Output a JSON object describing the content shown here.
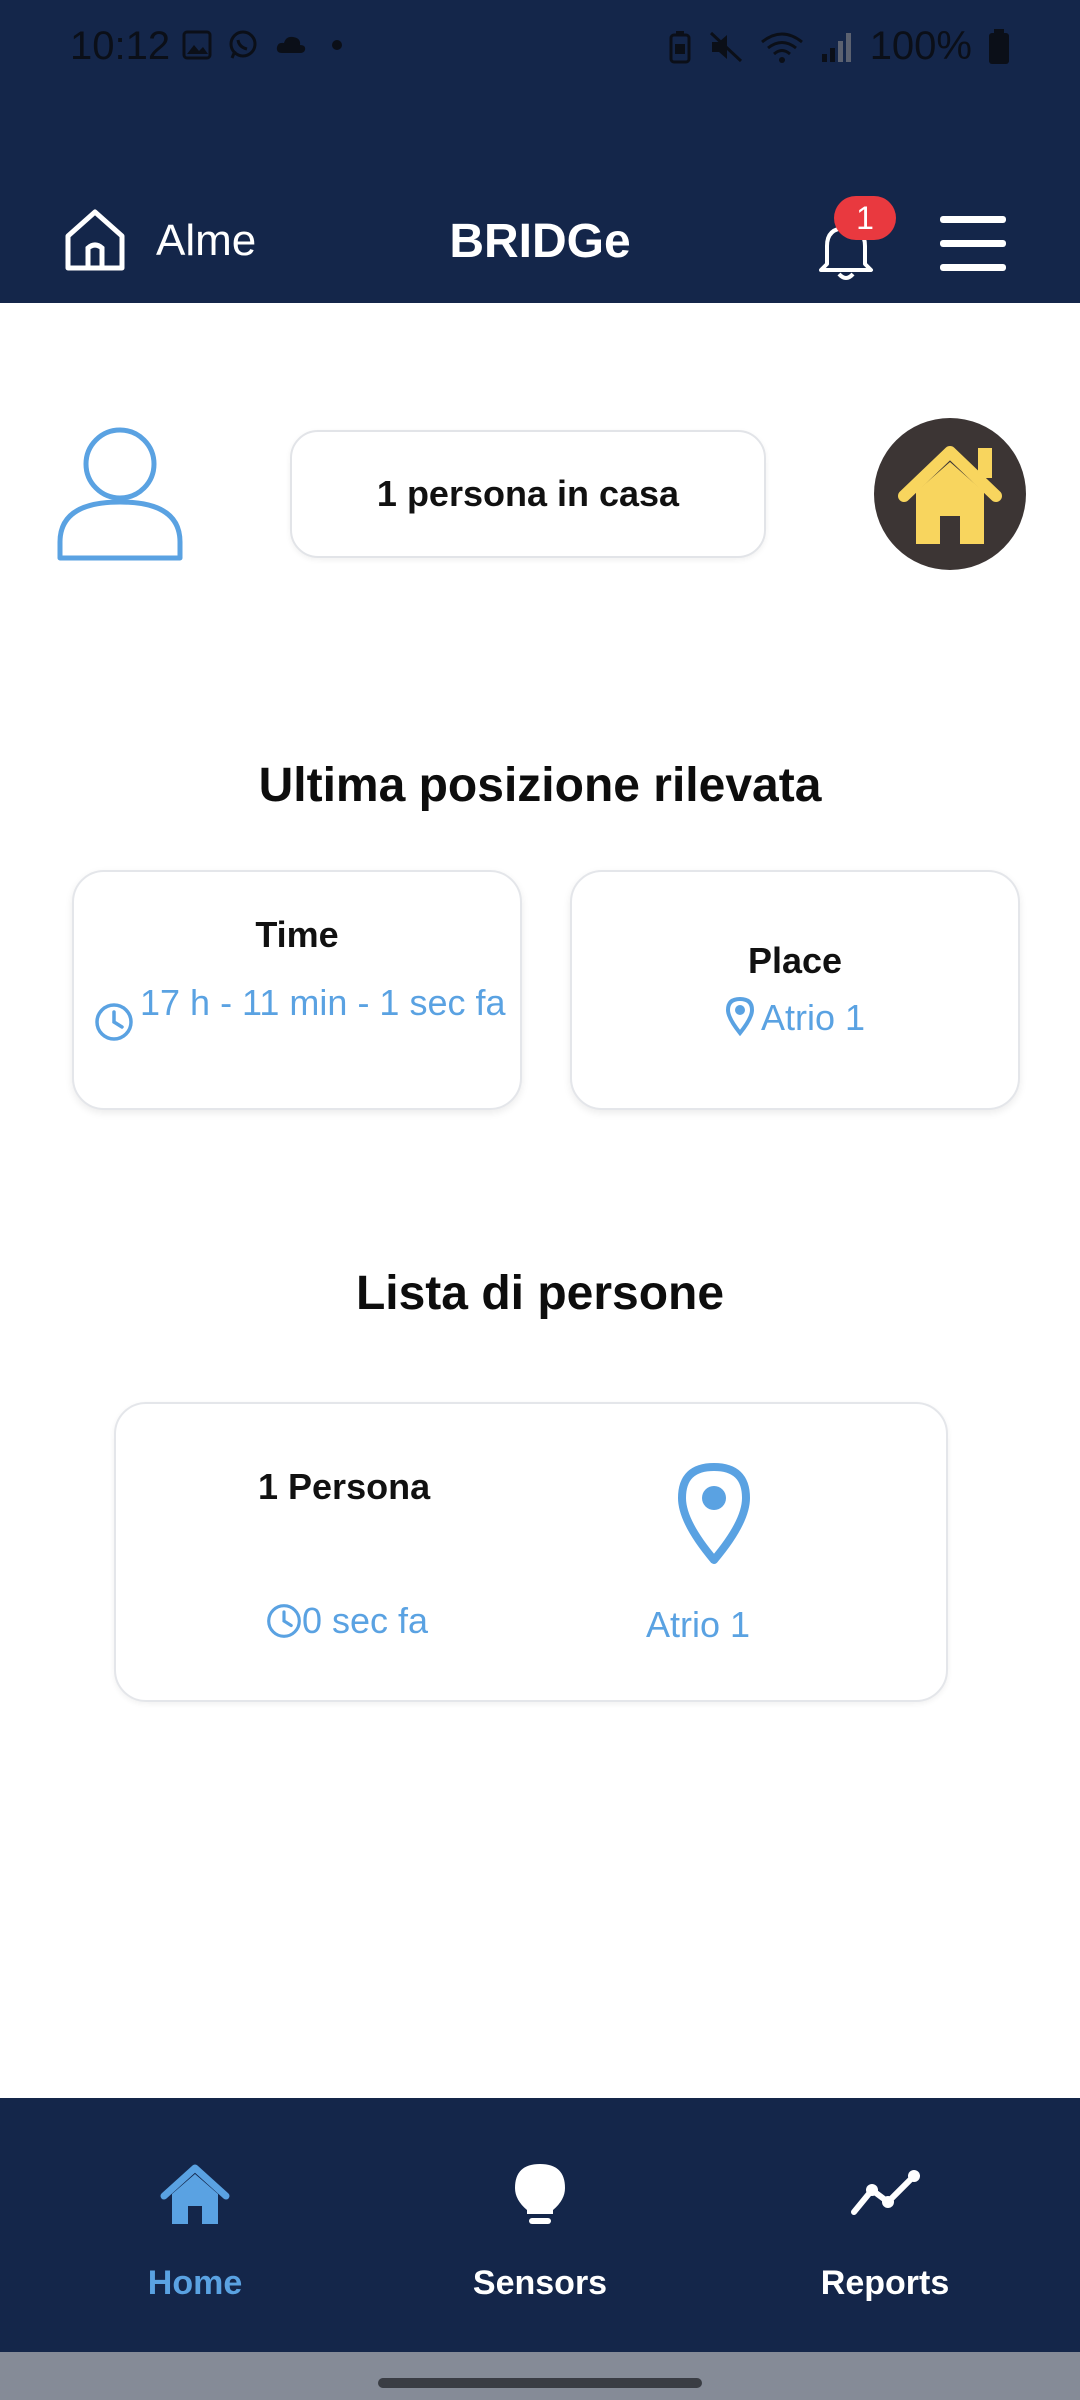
{
  "status_bar": {
    "time": "10:12",
    "battery": "100%"
  },
  "header": {
    "location": "Alme",
    "title": "BRIDGe",
    "notifications_count": "1"
  },
  "summary": {
    "people_in_home": "1 persona in casa"
  },
  "last_position": {
    "section_title": "Ultima posizione rilevata",
    "time_label": "Time",
    "time_value": "17 h - 11 min - 1 sec fa",
    "place_label": "Place",
    "place_value": "Atrio 1"
  },
  "people_list": {
    "section_title": "Lista di persone",
    "items": [
      {
        "name": "1 Persona",
        "last_seen": "0 sec fa",
        "place": "Atrio 1"
      }
    ]
  },
  "bottom_nav": {
    "items": [
      {
        "label": "Home",
        "icon": "home-icon",
        "active": true
      },
      {
        "label": "Sensors",
        "icon": "lightbulb-icon",
        "active": false
      },
      {
        "label": "Reports",
        "icon": "chart-line-icon",
        "active": false
      }
    ]
  },
  "colors": {
    "header_bg": "#14264a",
    "accent_blue": "#5aa2e2",
    "badge_red": "#e9393f",
    "house_yellow": "#f8d55e"
  }
}
